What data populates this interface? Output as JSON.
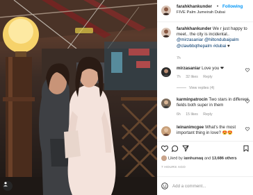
{
  "post": {
    "username": "farahkhankunder",
    "separator": "•",
    "follow_label": "Following",
    "location": "FIVE Palm Jumeirah Dubai",
    "caption_user": "farahkhankunder",
    "caption_text": " We r just happy to meet.. the city is incidental.. ",
    "caption_tags": "@mirzasaniar @hiltondubaipalm @clawbbqthepalm #dubai",
    "caption_heart": "♥",
    "caption_time": "7h"
  },
  "comments": [
    {
      "user": "mirzasaniar",
      "text": "Love you ❤",
      "time": "7h",
      "likes": "32 likes",
      "reply": "Reply"
    },
    {
      "user": "karminpatrocin",
      "text": "Two stars in different fields both super in them",
      "time": "6h",
      "likes": "15 likes",
      "reply": "Reply"
    },
    {
      "user": "leinanimcgee",
      "text": "What's the most important thing in love? 😍😍",
      "time": "",
      "likes": "",
      "reply": ""
    }
  ],
  "view_replies_label": "View replies (4)",
  "likes_line": {
    "prefix": "Liked by ",
    "user": "iamhumaq",
    "middle": " and ",
    "count": "13,686 others"
  },
  "time_ago": "7 HOURS AGO",
  "add_comment_placeholder": "Add a comment...",
  "icons": {
    "heart": "heart-icon",
    "comment": "comment-icon",
    "share": "share-icon",
    "save": "bookmark-icon",
    "emoji": "emoji-icon",
    "user_tag": "user-tag-icon"
  },
  "colors": {
    "follow": "#0095f6",
    "like_red": "#ed4956",
    "link": "#00376b",
    "muted": "#8e8e8e"
  }
}
